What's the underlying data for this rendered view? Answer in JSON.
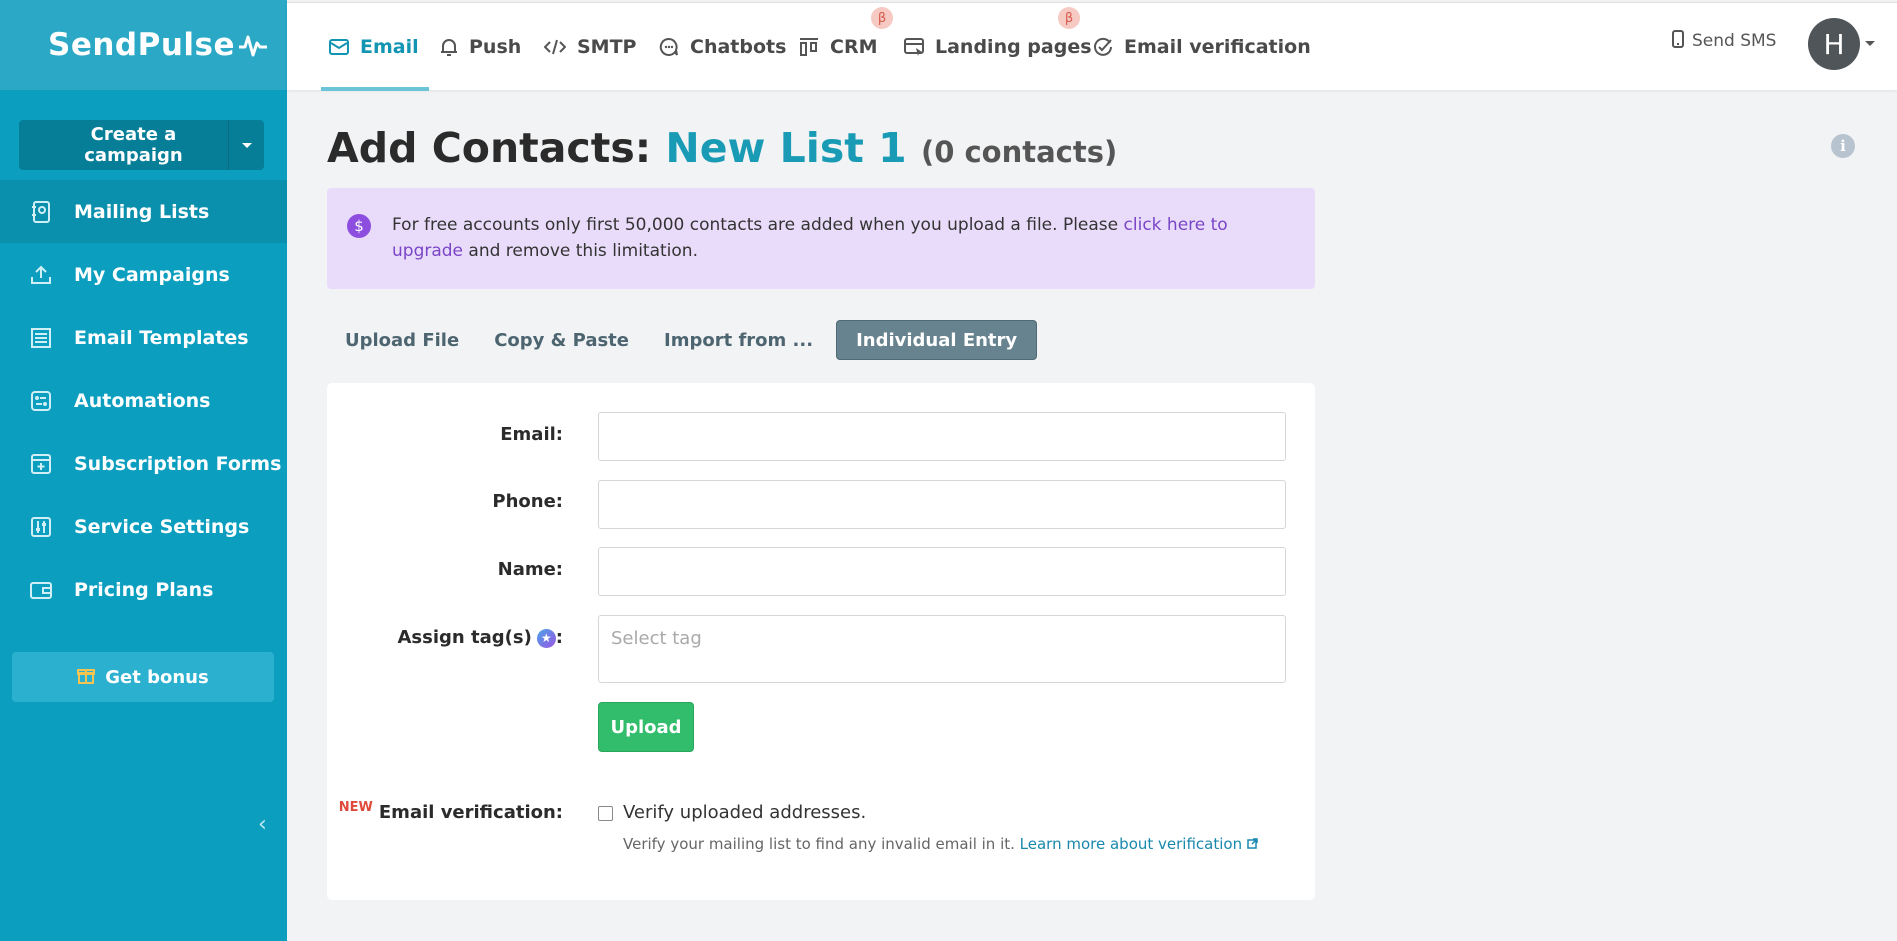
{
  "brand": {
    "name": "SendPulse"
  },
  "sidebar": {
    "create_label": "Create a campaign",
    "items": [
      {
        "label": "Mailing Lists",
        "icon": "address-book-icon",
        "active": true
      },
      {
        "label": "My Campaigns",
        "icon": "campaign-upload-icon"
      },
      {
        "label": "Email Templates",
        "icon": "template-icon"
      },
      {
        "label": "Automations",
        "icon": "automation-icon"
      },
      {
        "label": "Subscription Forms",
        "icon": "form-icon"
      },
      {
        "label": "Service Settings",
        "icon": "settings-sliders-icon"
      },
      {
        "label": "Pricing Plans",
        "icon": "wallet-icon"
      }
    ],
    "bonus_label": "Get bonus"
  },
  "topnav": {
    "tabs": [
      {
        "label": "Email",
        "icon": "envelope-icon",
        "active": true
      },
      {
        "label": "Push",
        "icon": "bell-icon"
      },
      {
        "label": "SMTP",
        "icon": "code-icon"
      },
      {
        "label": "Chatbots",
        "icon": "chat-icon"
      },
      {
        "label": "CRM",
        "icon": "kanban-icon",
        "beta": "β"
      },
      {
        "label": "Landing pages",
        "icon": "landing-icon",
        "beta": "β"
      },
      {
        "label": "Email verification",
        "icon": "check-circle-icon"
      }
    ],
    "send_sms": "Send SMS",
    "avatar_letter": "H"
  },
  "page": {
    "title_prefix": "Add Contacts:",
    "list_name": "New List 1",
    "contact_count": "(0 contacts)"
  },
  "notice": {
    "text": "For free accounts only first 50,000 contacts are added when you upload a file. Please ",
    "link": "click here to upgrade",
    "text_after": " and remove this limitation."
  },
  "subtabs": [
    {
      "label": "Upload File"
    },
    {
      "label": "Copy & Paste"
    },
    {
      "label": "Import from ..."
    },
    {
      "label": "Individual Entry",
      "active": true
    }
  ],
  "form": {
    "email_label": "Email:",
    "email_value": "",
    "phone_label": "Phone:",
    "phone_value": "",
    "name_label": "Name:",
    "name_value": "",
    "tags_label": "Assign tag(s)",
    "tags_colon": ":",
    "tags_placeholder": "Select tag",
    "upload_label": "Upload",
    "verify_new": "NEW",
    "verify_label": "Email verification:",
    "verify_checkbox": "Verify uploaded addresses.",
    "verify_note": "Verify your mailing list to find any invalid email in it. ",
    "verify_link": "Learn more about verification"
  },
  "colors": {
    "sidebar": "#0b9ebf",
    "accent": "#1a9bb5",
    "upload": "#31bd6b",
    "notice": "#e9dcfa"
  }
}
